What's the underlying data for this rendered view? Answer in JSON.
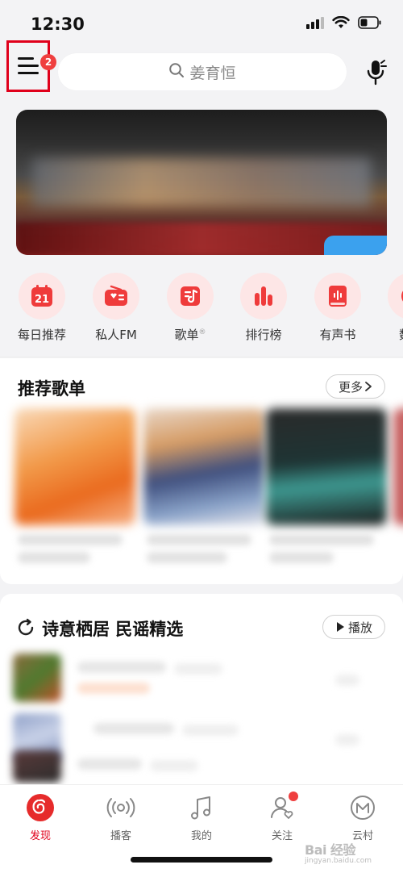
{
  "status_bar": {
    "time": "12:30"
  },
  "header": {
    "menu_badge": "2",
    "search_placeholder": "姜育恒"
  },
  "quick_entries": [
    {
      "label": "每日推荐",
      "icon": "calendar-icon",
      "date": "21"
    },
    {
      "label": "私人FM",
      "icon": "radio-icon"
    },
    {
      "label": "歌单",
      "icon": "playlist-icon",
      "mark": "®"
    },
    {
      "label": "排行榜",
      "icon": "chart-bars-icon"
    },
    {
      "label": "有声书",
      "icon": "audiobook-icon"
    },
    {
      "label": "数字",
      "icon": "digital-icon"
    }
  ],
  "recommended": {
    "title": "推荐歌单",
    "more_label": "更多",
    "more_icon": "chevron-right-icon"
  },
  "daily_section": {
    "title": "诗意栖居 民谣精选",
    "play_label": "播放",
    "refresh_icon": "refresh-icon"
  },
  "tabs": [
    {
      "label": "发现",
      "active": true,
      "icon": "discover-icon"
    },
    {
      "label": "播客",
      "active": false,
      "icon": "podcast-icon"
    },
    {
      "label": "我的",
      "active": false,
      "icon": "music-note-icon"
    },
    {
      "label": "关注",
      "active": false,
      "icon": "follow-icon",
      "dot": true
    },
    {
      "label": "云村",
      "active": false,
      "icon": "cloud-village-icon"
    }
  ],
  "watermark": {
    "main": "Bai 经验",
    "sub": "jingyan.baidu.com"
  },
  "colors": {
    "accent": "#e0001b",
    "badge": "#ef3f3f",
    "icon_bg": "#fde6e6",
    "background": "#f3f3f5"
  }
}
